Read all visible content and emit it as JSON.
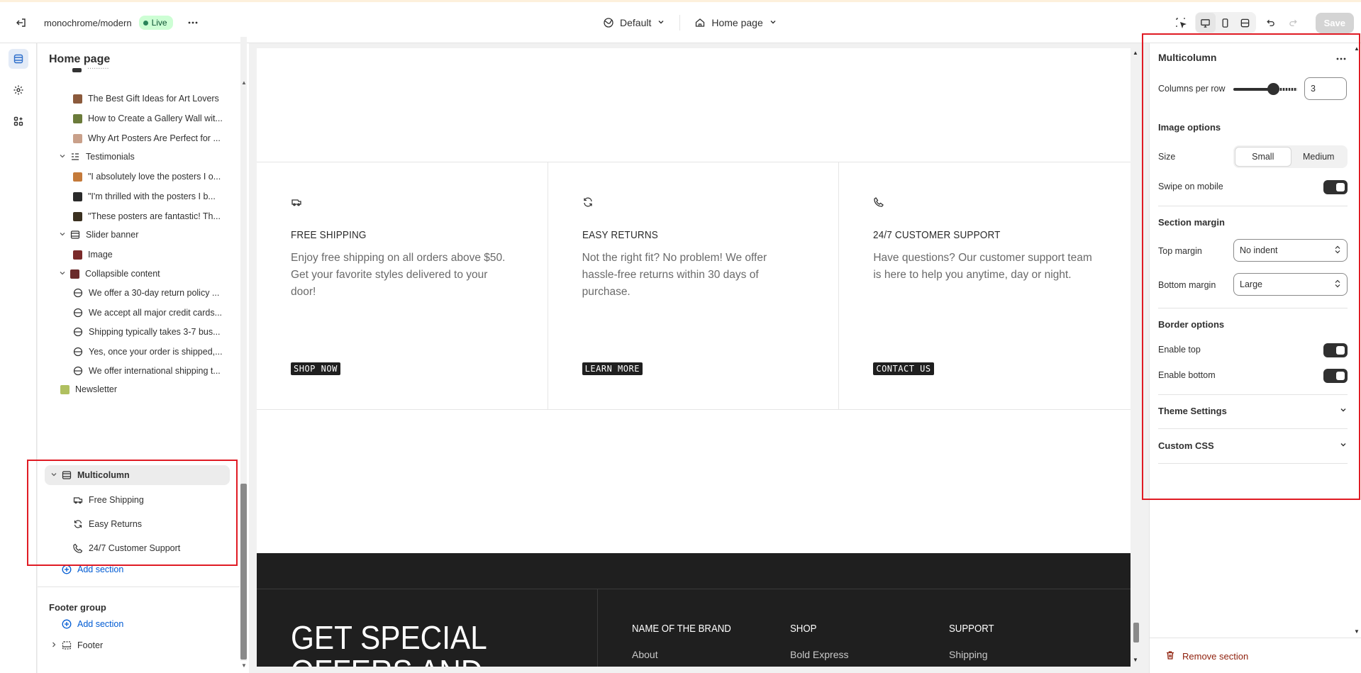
{
  "topbar": {
    "store_name": "monochrome/modern",
    "status": "Live",
    "theme_dropdown": "Default",
    "page_dropdown": "Home page",
    "save_label": "Save"
  },
  "left_panel": {
    "title": "Home page",
    "tree": [
      {
        "label": "The Best Gift Ideas for Art Lovers",
        "level": 2,
        "thumb": "#8b5a3c"
      },
      {
        "label": "How to Create a Gallery Wall wit...",
        "level": 2,
        "thumb": "#6b7b3a"
      },
      {
        "label": "Why Art Posters Are Perfect for ...",
        "level": 2,
        "thumb": "#c9a08a"
      },
      {
        "label": "Testimonials",
        "level": 1,
        "icon": "testimonials-icon"
      },
      {
        "label": "\"I absolutely love the posters I o...",
        "level": 2,
        "thumb": "#c47a3a"
      },
      {
        "label": "\"I'm thrilled with the posters I b...",
        "level": 2,
        "thumb": "#2a2a2a"
      },
      {
        "label": "\"These posters are fantastic! Th...",
        "level": 2,
        "thumb": "#3a3020"
      },
      {
        "label": "Slider banner",
        "level": 1,
        "icon": "slider-icon"
      },
      {
        "label": "Image",
        "level": 2,
        "thumb": "#7a2a2a"
      },
      {
        "label": "Collapsible content",
        "level": 1,
        "thumb": "#6a2a2a"
      },
      {
        "label": "We offer a 30-day return policy ...",
        "level": 2,
        "icon": "row-icon"
      },
      {
        "label": "We accept all major credit cards...",
        "level": 2,
        "icon": "row-icon"
      },
      {
        "label": "Shipping typically takes 3-7 bus...",
        "level": 2,
        "icon": "row-icon"
      },
      {
        "label": "Yes, once your order is shipped,...",
        "level": 2,
        "icon": "row-icon"
      },
      {
        "label": "We offer international shipping t...",
        "level": 2,
        "icon": "row-icon"
      },
      {
        "label": "Newsletter",
        "level": 1,
        "thumb": "#b0c060"
      },
      {
        "label": "Multicolumn",
        "level": 1,
        "icon": "multicolumn-icon"
      },
      {
        "label": "Free Shipping",
        "level": 2,
        "icon": "truck-icon"
      },
      {
        "label": "Easy Returns",
        "level": 2,
        "icon": "refresh-icon"
      },
      {
        "label": "24/7 Customer Support",
        "level": 2,
        "icon": "phone-icon"
      }
    ],
    "add_section": "Add section",
    "footer_group": "Footer group",
    "footer_add_section": "Add section",
    "footer_item": "Footer"
  },
  "preview": {
    "columns": [
      {
        "icon": "truck-icon",
        "heading": "FREE SHIPPING",
        "text": "Enjoy free shipping on all orders above $50. Get your favorite styles delivered to your door!",
        "button": "SHOP NOW"
      },
      {
        "icon": "refresh-icon",
        "heading": "EASY RETURNS",
        "text": "Not the right fit? No problem! We offer hassle-free returns within 30 days of purchase.",
        "button": "LEARN MORE"
      },
      {
        "icon": "phone-icon",
        "heading": "24/7 CUSTOMER SUPPORT",
        "text": "Have questions? Our customer support team is here to help you anytime, day or night.",
        "button": "CONTACT US"
      }
    ],
    "footer": {
      "big_text_1": "GET SPECIAL",
      "big_text_2": "OFFERS AND",
      "cols": [
        {
          "heading": "NAME OF THE BRAND",
          "link": "About"
        },
        {
          "heading": "SHOP",
          "link": "Bold Express"
        },
        {
          "heading": "SUPPORT",
          "link": "Shipping"
        }
      ]
    }
  },
  "right_panel": {
    "title": "Multicolumn",
    "columns_per_row_label": "Columns per row",
    "columns_per_row_value": "3",
    "columns_per_row_fraction": 0.67,
    "image_options": "Image options",
    "size_label": "Size",
    "size_options": [
      "Small",
      "Medium"
    ],
    "size_selected": "Small",
    "swipe_label": "Swipe on mobile",
    "section_margin": "Section margin",
    "top_margin_label": "Top margin",
    "top_margin_value": "No indent",
    "bottom_margin_label": "Bottom margin",
    "bottom_margin_value": "Large",
    "border_options": "Border options",
    "enable_top_label": "Enable top",
    "enable_bottom_label": "Enable bottom",
    "theme_settings": "Theme Settings",
    "custom_css": "Custom CSS",
    "remove_section": "Remove section"
  },
  "colors": {
    "accent_blue": "#005bd3",
    "highlight_red": "#e01b24",
    "live_green": "#cdfed4",
    "dark_footer": "#1f1f1f",
    "remove_red": "#8e1f0b"
  }
}
